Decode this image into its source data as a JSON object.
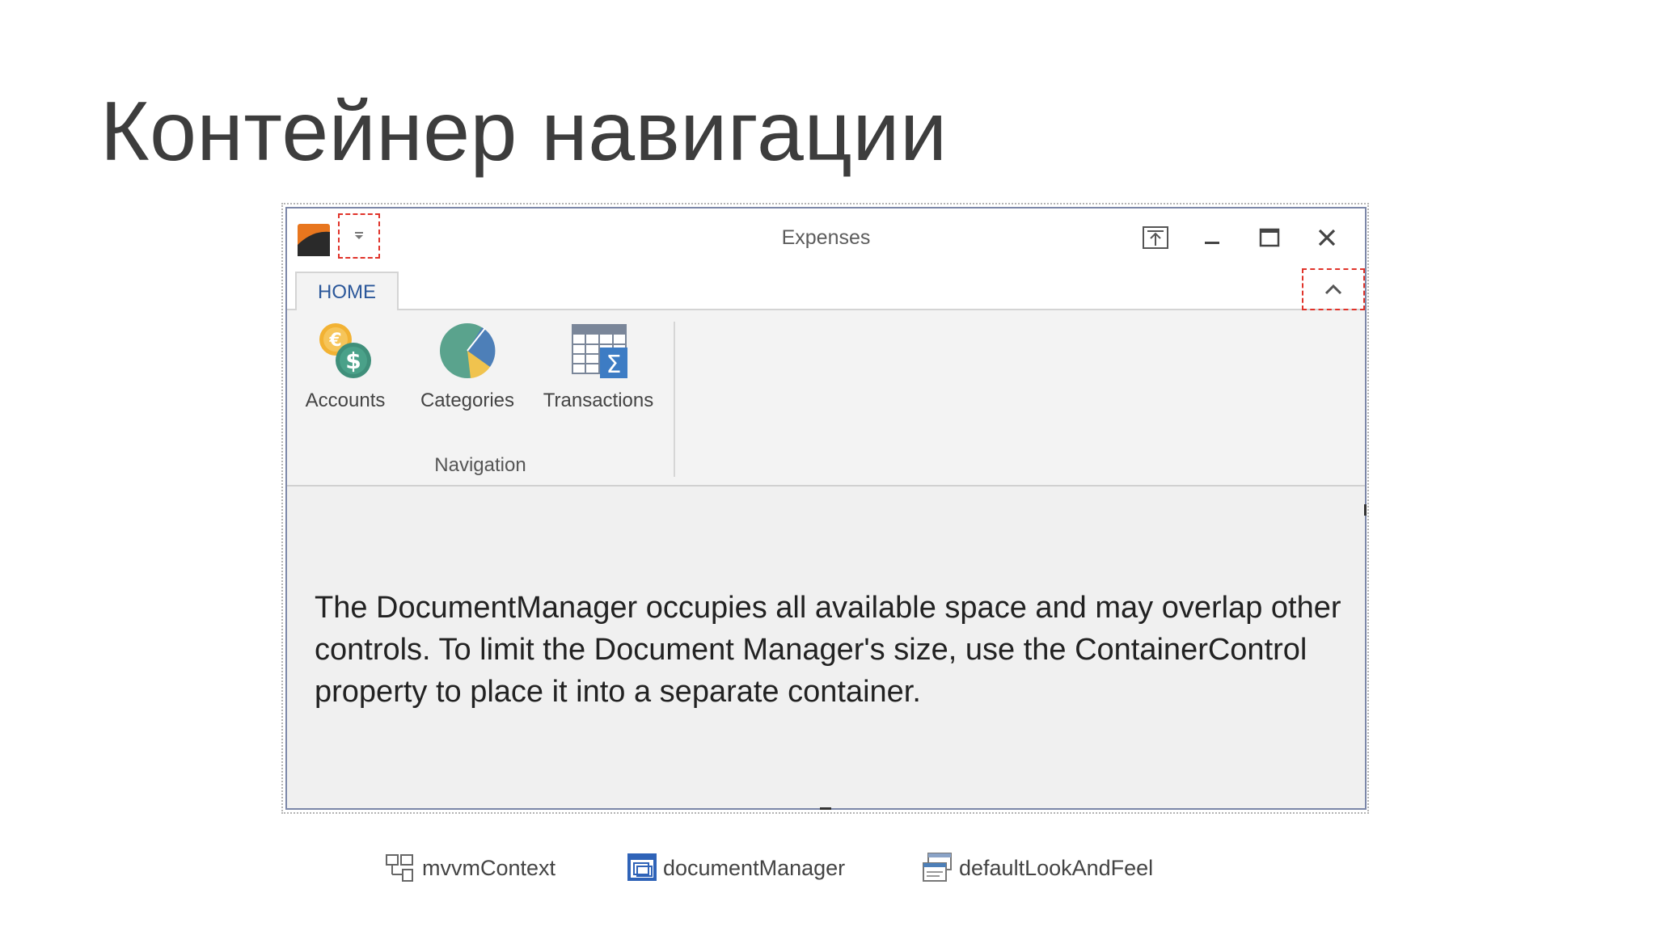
{
  "slide": {
    "title": "Контейнер навигации"
  },
  "window": {
    "title": "Expenses",
    "buttons": {
      "dock": "dock-top-icon",
      "minimize": "minimize-icon",
      "maximize": "maximize-icon",
      "close": "close-icon"
    }
  },
  "ribbon": {
    "tabs": [
      {
        "label": "HOME",
        "selected": true
      }
    ],
    "groups": [
      {
        "label": "Navigation",
        "items": [
          {
            "label": "Accounts",
            "icon": "currency-coins-icon"
          },
          {
            "label": "Categories",
            "icon": "pie-chart-icon"
          },
          {
            "label": "Transactions",
            "icon": "table-sum-icon"
          }
        ]
      }
    ]
  },
  "document": {
    "message": "The DocumentManager occupies all available space and may overlap other controls. To limit the Document Manager's size, use the ContainerControl property to place it into a separate container."
  },
  "component_tray": [
    {
      "label": "mvvmContext",
      "icon": "mvvm-context-icon"
    },
    {
      "label": "documentManager",
      "icon": "document-manager-icon"
    },
    {
      "label": "defaultLookAndFeel",
      "icon": "look-and-feel-icon"
    }
  ],
  "colors": {
    "accent": "#2b579a",
    "highlight_dash": "#e0332a",
    "window_border": "#7c87a8"
  }
}
